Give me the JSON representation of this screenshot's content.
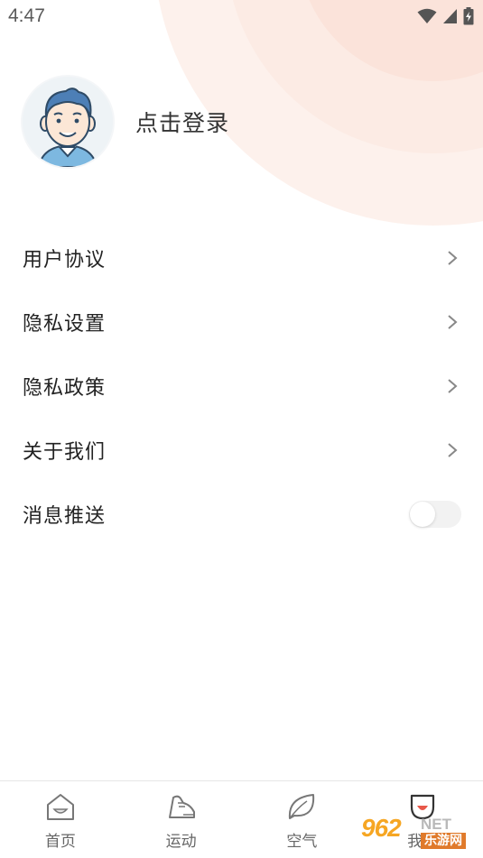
{
  "status_bar": {
    "time": "4:47",
    "icons": [
      "wifi-icon",
      "signal-icon",
      "battery-charging-icon"
    ]
  },
  "profile": {
    "avatar_icon": "user-avatar",
    "login_label": "点击登录"
  },
  "menu": {
    "items": [
      {
        "label": "用户协议",
        "icon": "chevron-right-icon"
      },
      {
        "label": "隐私设置",
        "icon": "chevron-right-icon"
      },
      {
        "label": "隐私政策",
        "icon": "chevron-right-icon"
      },
      {
        "label": "关于我们",
        "icon": "chevron-right-icon"
      }
    ],
    "push": {
      "label": "消息推送",
      "enabled": false
    }
  },
  "tab_bar": {
    "tabs": [
      {
        "label": "首页",
        "icon": "home-icon"
      },
      {
        "label": "运动",
        "icon": "sneaker-icon"
      },
      {
        "label": "空气",
        "icon": "leaf-icon"
      },
      {
        "label": "我的",
        "icon": "cup-icon",
        "active": true
      }
    ]
  },
  "watermark": {
    "number": "962",
    "suffix": "NET",
    "site": "乐游网"
  },
  "colors": {
    "accent": "#e8584a",
    "background_arc": "#fbe3da"
  }
}
